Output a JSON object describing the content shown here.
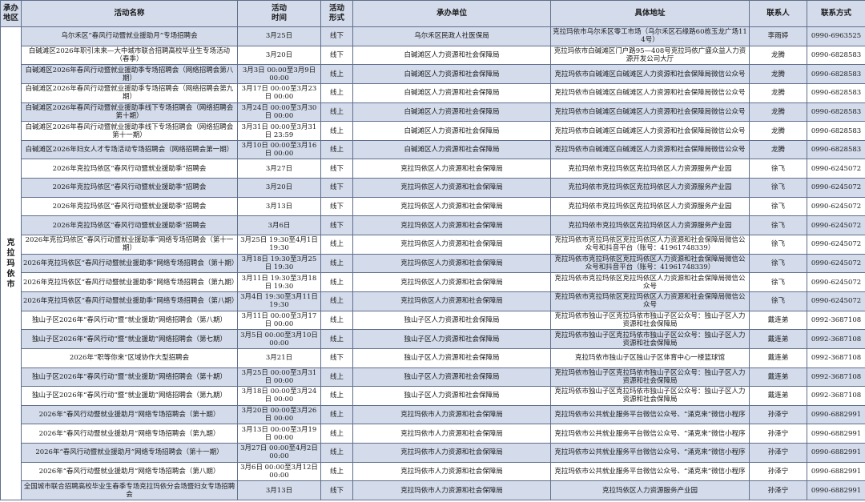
{
  "headers": [
    "承办\n地区",
    "活动名称",
    "活动\n时间",
    "活动\n形式",
    "承办单位",
    "具体地址",
    "联系人",
    "联系方式"
  ],
  "region": "克\n拉\n玛\n依\n市",
  "rows": [
    [
      "乌尔禾区“春风行动暨就业援助月”专场招聘会",
      "3月25日",
      "线下",
      "乌尔禾区民政人社医保局",
      "克拉玛依市乌尔禾区零工市场（乌尔禾区石缘路60栋玉龙广场114号）",
      "李雨婷",
      "0990-6963525"
    ],
    [
      "白碱滩区2026年职引未来—大中城市联合招聘高校毕业生专场活动（春季）",
      "3月20日",
      "线下",
      "白碱滩区人力资源和社会保障局",
      "克拉玛依市白碱滩区门户路95—408号克拉玛依广盛众益人力资源开发公司大厅",
      "龙腾",
      "0990-6828583"
    ],
    [
      "白碱滩区2026年春风行动暨就业援助季专场招聘会（网络招聘会第八期）",
      "3月3日  00:00至3月9日  00:00",
      "线上",
      "白碱滩区人力资源和社会保障局",
      "克拉玛依市白碱滩区白碱滩区人力资源和社会保障局微信公众号",
      "龙腾",
      "0990-6828583"
    ],
    [
      "白碱滩区2026年春风行动暨就业援助季专场招聘会（网络招聘会第九期）",
      "3月17日  00:00至3月23日  00:00",
      "线上",
      "白碱滩区人力资源和社会保障局",
      "克拉玛依市白碱滩区白碱滩区人力资源和社会保障局微信公众号",
      "龙腾",
      "0990-6828583"
    ],
    [
      "白碱滩区2026年春风行动暨就业援助季线下专场招聘会（网络招聘会第十期）",
      "3月24日  00:00至3月30日  00:00",
      "线上",
      "白碱滩区人力资源和社会保障局",
      "克拉玛依市白碱滩区白碱滩区人力资源和社会保障局微信公众号",
      "龙腾",
      "0990-6828583"
    ],
    [
      "白碱滩区2026年春风行动暨就业援助季线下专场招聘会（网络招聘会第十一期）",
      "3月31日  00:00至3月31日  23:59",
      "线上",
      "白碱滩区人力资源和社会保障局",
      "克拉玛依市白碱滩区白碱滩区人力资源和社会保障局微信公众号",
      "龙腾",
      "0990-6828583"
    ],
    [
      "白碱滩区2026年妇女人才专场活动专场招聘会（网络招聘会第一期）",
      "3月10日  00:00至3月16日  00:00",
      "线上",
      "白碱滩区人力资源和社会保障局",
      "克拉玛依市白碱滩区白碱滩区人力资源和社会保障局微信公众号",
      "龙腾",
      "0990-6828583"
    ],
    [
      "2026年克拉玛依区“春风行动暨就业援助季”招聘会",
      "3月27日",
      "线下",
      "克拉玛依区人力资源和社会保障局",
      "克拉玛依市克拉玛依区克拉玛依区人力资源服务产业园",
      "徐飞",
      "0990-6245072"
    ],
    [
      "2026年克拉玛依区“春风行动暨就业援助季”招聘会",
      "3月20日",
      "线下",
      "克拉玛依区人力资源和社会保障局",
      "克拉玛依市克拉玛依区克拉玛依区人力资源服务产业园",
      "徐飞",
      "0990-6245072"
    ],
    [
      "2026年克拉玛依区“春风行动暨就业援助季”招聘会",
      "3月13日",
      "线下",
      "克拉玛依区人力资源和社会保障局",
      "克拉玛依市克拉玛依区克拉玛依区人力资源服务产业园",
      "徐飞",
      "0990-6245072"
    ],
    [
      "2026年克拉玛依区“春风行动暨就业援助季”招聘会",
      "3月6日",
      "线下",
      "克拉玛依区人力资源和社会保障局",
      "克拉玛依市克拉玛依区克拉玛依区人力资源服务产业园",
      "徐飞",
      "0990-6245072"
    ],
    [
      "2026年克拉玛依区“春风行动暨就业援助季”网络专场招聘会（第十一期）",
      "3月25日  19:30至4月1日  19:30",
      "线上",
      "克拉玛依区人力资源和社会保障局",
      "克拉玛依市克拉玛依区克拉玛依区人力资源和社会保障局微信公众号和抖音平台（账号：4196174​8339）",
      "徐飞",
      "0990-6245072"
    ],
    [
      "2026年克拉玛依区“春风行动暨就业援助季”网络专场招聘会（第十期）",
      "3月18日  19:30至3月25日  19:30",
      "线上",
      "克拉玛依区人力资源和社会保障局",
      "克拉玛依市克拉玛依区克拉玛依区人力资源和社会保障局微信公众号和抖音平台（账号：4196174​8339）",
      "徐飞",
      "0990-6245072"
    ],
    [
      "2026年克拉玛依区“春风行动暨就业援助季”网络专场招聘会（第九期）",
      "3月11日  19:30至3月18日  19:30",
      "线上",
      "克拉玛依区人力资源和社会保障局",
      "克拉玛依市克拉玛依区克拉玛依区人力资源和社会保障局微信公众号",
      "徐飞",
      "0990-6245072"
    ],
    [
      "2026年克拉玛依区“春风行动暨就业援助季”网络专场招聘会（第八期）",
      "3月4日  19:30至3月11日  19:30",
      "线上",
      "克拉玛依区人力资源和社会保障局",
      "克拉玛依市克拉玛依区克拉玛依区人力资源和社会保障局微信公众号",
      "徐飞",
      "0990-6245072"
    ],
    [
      "独山子区2026年“春风行动”暨“就业援助”网络招聘会（第八期）",
      "3月11日  00:00至3月17日  00:00",
      "线上",
      "独山子区人力资源和社会保障局",
      "克拉玛依市独山子区克拉玛依市独山子区公众号：独山子区人力资源和社会保障局",
      "戴连弟",
      "0992-3687108"
    ],
    [
      "独山子区2026年“春风行动”暨“就业援助”网络招聘会（第七期）",
      "3月5日  00:00至3月10日  00:00",
      "线上",
      "独山子区人力资源和社会保障局",
      "克拉玛依市独山子区克拉玛依市独山子区公众号：独山子区人力资源和社会保障局",
      "戴连弟",
      "0992-3687108"
    ],
    [
      "2026年“职等你来”区域协作大型招聘会",
      "3月21日",
      "线下",
      "独山子区人力资源和社会保障局",
      "克拉玛依市独山子区独山子区体育中心一楼篮球馆",
      "戴连弟",
      "0992-3687108"
    ],
    [
      "独山子区2026年“春风行动”暨“就业援助”网络招聘会（第十期）",
      "3月25日  00:00至3月31日  00:00",
      "线上",
      "独山子区人力资源和社会保障局",
      "克拉玛依市独山子区克拉玛依市独山子区公众号：独山子区人力资源和社会保障局",
      "戴连弟",
      "0992-3687108"
    ],
    [
      "独山子区2026年“春风行动”暨“就业援助”网络招聘会（第九期）",
      "3月18日  00:00至3月24日  00:00",
      "线上",
      "独山子区人力资源和社会保障局",
      "克拉玛依市独山子区克拉玛依市独山子区公众号：独山子区人力资源和社会保障局",
      "戴连弟",
      "0992-3687108"
    ],
    [
      "2026年“春风行动暨就业援助月”网络专场招聘会（第十期）",
      "3月20日  00:00至3月26日  00:00",
      "线上",
      "克拉玛依市人力资源和社会保障局",
      "克拉玛依市公共就业服务平台微信公众号、“涌克来”微信小程序",
      "孙泽宁",
      "0990-6882991"
    ],
    [
      "2026年“春风行动暨就业援助月”网络专场招聘会（第九期）",
      "3月13日  00:00至3月19日  00:00",
      "线上",
      "克拉玛依市人力资源和社会保障局",
      "克拉玛依市公共就业服务平台微信公众号、“涌克来”微信小程序",
      "孙泽宁",
      "0990-6882991"
    ],
    [
      "2026年“春风行动暨就业援助月”网络专场招聘会（第十一期）",
      "3月27日  00:00至4月2日  00:00",
      "线上",
      "克拉玛依市人力资源和社会保障局",
      "克拉玛依市公共就业服务平台微信公众号、“涌克来”微信小程序",
      "孙泽宁",
      "0990-6882991"
    ],
    [
      "2026年“春风行动暨就业援助月”网络专场招聘会（第八期）",
      "3月6日  00:00至3月12日  00:00",
      "线上",
      "克拉玛依市人力资源和社会保障局",
      "克拉玛依市公共就业服务平台微信公众号、“涌克来”微信小程序",
      "孙泽宁",
      "0990-6882991"
    ],
    [
      "全国城市联合招聘高校毕业生春季专场克拉玛依分会场暨妇女专场招聘会",
      "3月13日",
      "线下",
      "克拉玛依市人力资源和社会保障局",
      "克拉玛依区人力资源服务产业园",
      "孙泽宁",
      "0990-6882991"
    ]
  ]
}
